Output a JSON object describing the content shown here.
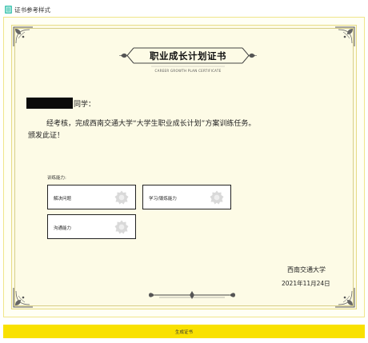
{
  "header": {
    "icon": "certificate-icon",
    "title": "证书参考样式"
  },
  "certificate": {
    "title": "职业成长计划证书",
    "subtitle": "CAREER GROWTH PLAN CERTIFICATE",
    "name_suffix": "同学：",
    "body_line1": "经考核，完成西南交通大学“大学生职业成长计划”方案训练任务。",
    "body_line2": "颁发此证！",
    "abilities_label": "训练能力:",
    "abilities": [
      {
        "label": "解决问题",
        "icon": "seal-icon"
      },
      {
        "label": "学习/锻炼能力",
        "icon": "seal-icon"
      },
      {
        "label": "沟通能力",
        "icon": "seal-icon"
      }
    ],
    "issuer": "西南交通大学",
    "issue_date": "2021年11月24日"
  },
  "actions": {
    "generate_label": "生成证书"
  },
  "colors": {
    "accent": "#f9e100",
    "border": "#e7dc86",
    "background": "#fdfbe6",
    "header_icon": "#48c7b4"
  }
}
